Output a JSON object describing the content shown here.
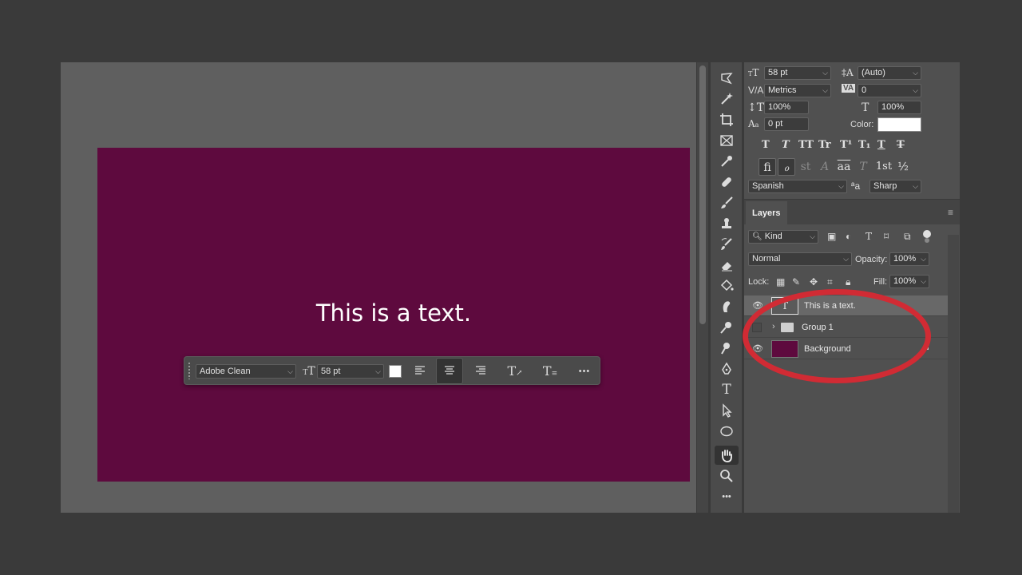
{
  "canvas": {
    "text": "This is a text.",
    "artboard_color": "#5e0a3e"
  },
  "taskbar": {
    "font_family": "Adobe Clean",
    "font_size": "58 pt",
    "color_swatch": "#ffffff",
    "more": "•••"
  },
  "toolbar": {
    "tools": [
      "lasso-icon",
      "magic-wand-icon",
      "crop-icon",
      "frame-icon",
      "eyedropper-icon",
      "healing-brush-icon",
      "brush-icon",
      "clone-stamp-icon",
      "history-brush-icon",
      "eraser-icon",
      "paint-bucket-icon",
      "smudge-icon",
      "dodge-icon",
      "pen-icon",
      "type-icon",
      "path-selection-icon",
      "ellipse-icon",
      "hand-icon",
      "zoom-icon",
      "more-tools-icon"
    ],
    "type_tool_label": "T",
    "more_label": "•••"
  },
  "character": {
    "font_size": "58 pt",
    "leading": "(Auto)",
    "kerning": "Metrics",
    "tracking": "0",
    "vertical_scale": "100%",
    "horizontal_scale": "100%",
    "baseline_shift": "0 pt",
    "color_label": "Color:",
    "style_buttons": [
      "T",
      "T",
      "TT",
      "Tr",
      "T¹",
      "T₁",
      "T",
      "T"
    ],
    "opentype_buttons": [
      "fi",
      "ℴ",
      "st",
      "A",
      "aa",
      "T",
      "1st",
      "½"
    ],
    "language": "Spanish",
    "aa_label": "ªa",
    "antialias": "Sharp"
  },
  "layers": {
    "tab": "Layers",
    "kind": "Kind",
    "blend_mode": "Normal",
    "opacity_label": "Opacity:",
    "opacity": "100%",
    "lock_label": "Lock:",
    "fill_label": "Fill:",
    "fill": "100%",
    "items": [
      {
        "name": "This is a text.",
        "type": "text",
        "visible": true,
        "selected": true
      },
      {
        "name": "Group 1",
        "type": "group",
        "visible": false,
        "selected": false
      },
      {
        "name": "Background",
        "type": "background",
        "visible": true,
        "selected": false,
        "locked": true
      }
    ]
  },
  "annotation": {
    "color": "#d12b34"
  }
}
